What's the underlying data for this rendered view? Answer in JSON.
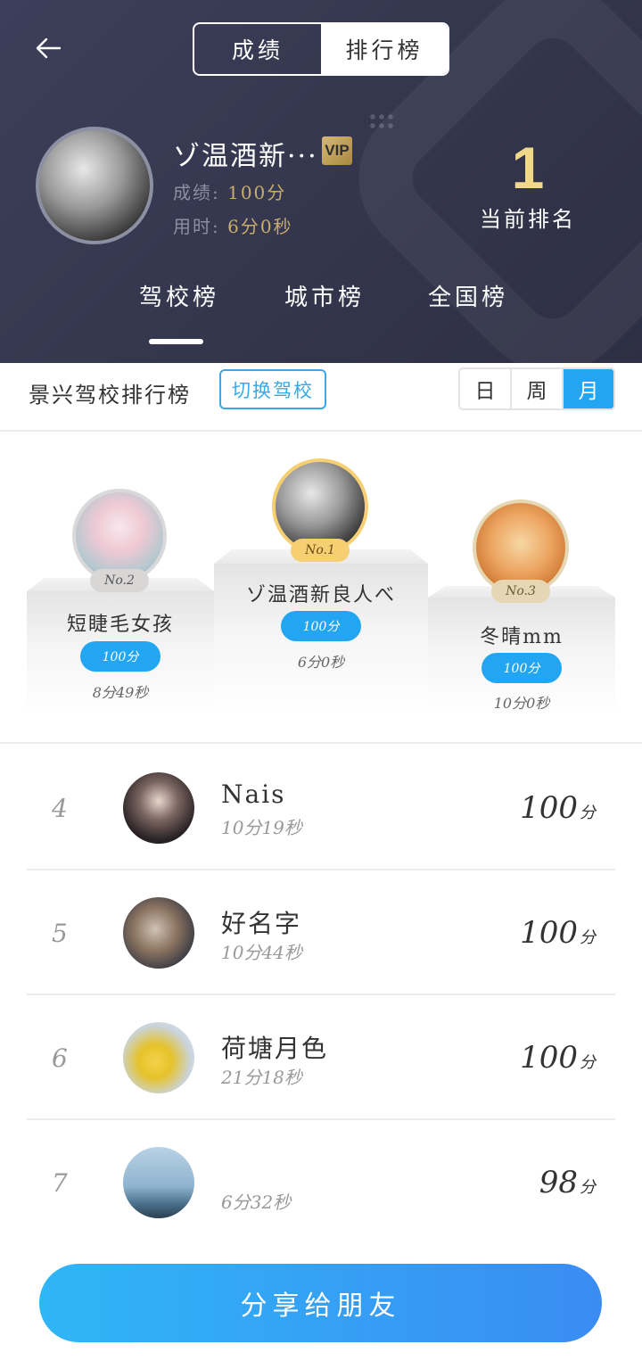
{
  "header": {
    "segments": [
      "成绩",
      "排行榜"
    ],
    "active_segment": 1,
    "user": {
      "name": "ゾ温酒新···",
      "vip_label": "VIP",
      "score_label": "成绩:",
      "score_value": "100分",
      "time_label": "用时:",
      "time_value": "6分0秒"
    },
    "rank": {
      "value": "1",
      "label": "当前排名"
    },
    "tabs": [
      "驾校榜",
      "城市榜",
      "全国榜"
    ],
    "active_tab": 0
  },
  "filter": {
    "title": "景兴驾校排行榜",
    "switch_label": "切换驾校",
    "periods": [
      "日",
      "周",
      "月"
    ],
    "active_period": 2
  },
  "podium": {
    "first": {
      "badge": "No.1",
      "name": "ゾ温酒新良人べ",
      "score": "100分",
      "time": "6分0秒"
    },
    "second": {
      "badge": "No.2",
      "name": "短睫毛女孩",
      "score": "100分",
      "time": "8分49秒"
    },
    "third": {
      "badge": "No.3",
      "name": "冬晴mm",
      "score": "100分",
      "time": "10分0秒"
    }
  },
  "list": [
    {
      "rank": "4",
      "name": "Nais",
      "time": "10分19秒",
      "score": "100",
      "unit": "分"
    },
    {
      "rank": "5",
      "name": "好名字",
      "time": "10分44秒",
      "score": "100",
      "unit": "分"
    },
    {
      "rank": "6",
      "name": "荷塘月色",
      "time": "21分18秒",
      "score": "100",
      "unit": "分"
    },
    {
      "rank": "7",
      "name": "",
      "time": "6分32秒",
      "score": "98",
      "unit": "分"
    }
  ],
  "share_label": "分享给朋友",
  "colors": {
    "accent": "#23a6f2",
    "header_bg": "#3a3c55",
    "gold": "#f1d98a"
  }
}
